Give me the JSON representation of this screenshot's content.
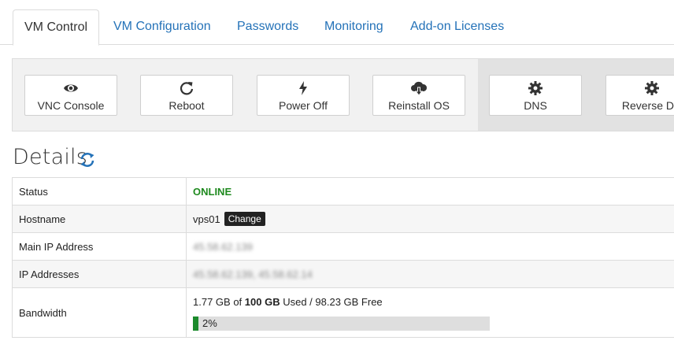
{
  "tabs": [
    {
      "label": "VM Control",
      "active": true
    },
    {
      "label": "VM Configuration"
    },
    {
      "label": "Passwords"
    },
    {
      "label": "Monitoring"
    },
    {
      "label": "Add-on Licenses"
    }
  ],
  "actions": [
    {
      "label": "VNC Console",
      "icon": "eye-icon"
    },
    {
      "label": "Reboot",
      "icon": "refresh-icon"
    },
    {
      "label": "Power Off",
      "icon": "bolt-icon"
    },
    {
      "label": "Reinstall OS",
      "icon": "cloud-download-icon"
    },
    {
      "label": "DNS",
      "icon": "gear-icon"
    },
    {
      "label": "Reverse DN",
      "icon": "gear-icon"
    }
  ],
  "details": {
    "title": "Details",
    "rows": {
      "status": {
        "label": "Status",
        "value": "ONLINE"
      },
      "hostname": {
        "label": "Hostname",
        "value": "vps01",
        "button": "Change"
      },
      "main_ip": {
        "label": "Main IP Address",
        "value": "45.58.62.139"
      },
      "ip_addresses": {
        "label": "IP Addresses",
        "value": "45.58.62.139, 45.58.62.14"
      },
      "bandwidth": {
        "label": "Bandwidth",
        "used": "1.77 GB",
        "of_text": " of ",
        "total": "100 GB",
        "used_text": " Used / ",
        "free": "98.23 GB Free",
        "percent_label": "2%",
        "percent": 0.02
      }
    }
  },
  "colors": {
    "accent": "#2472b8",
    "online": "#1f8a1f",
    "progress": "#1b8a2c"
  }
}
